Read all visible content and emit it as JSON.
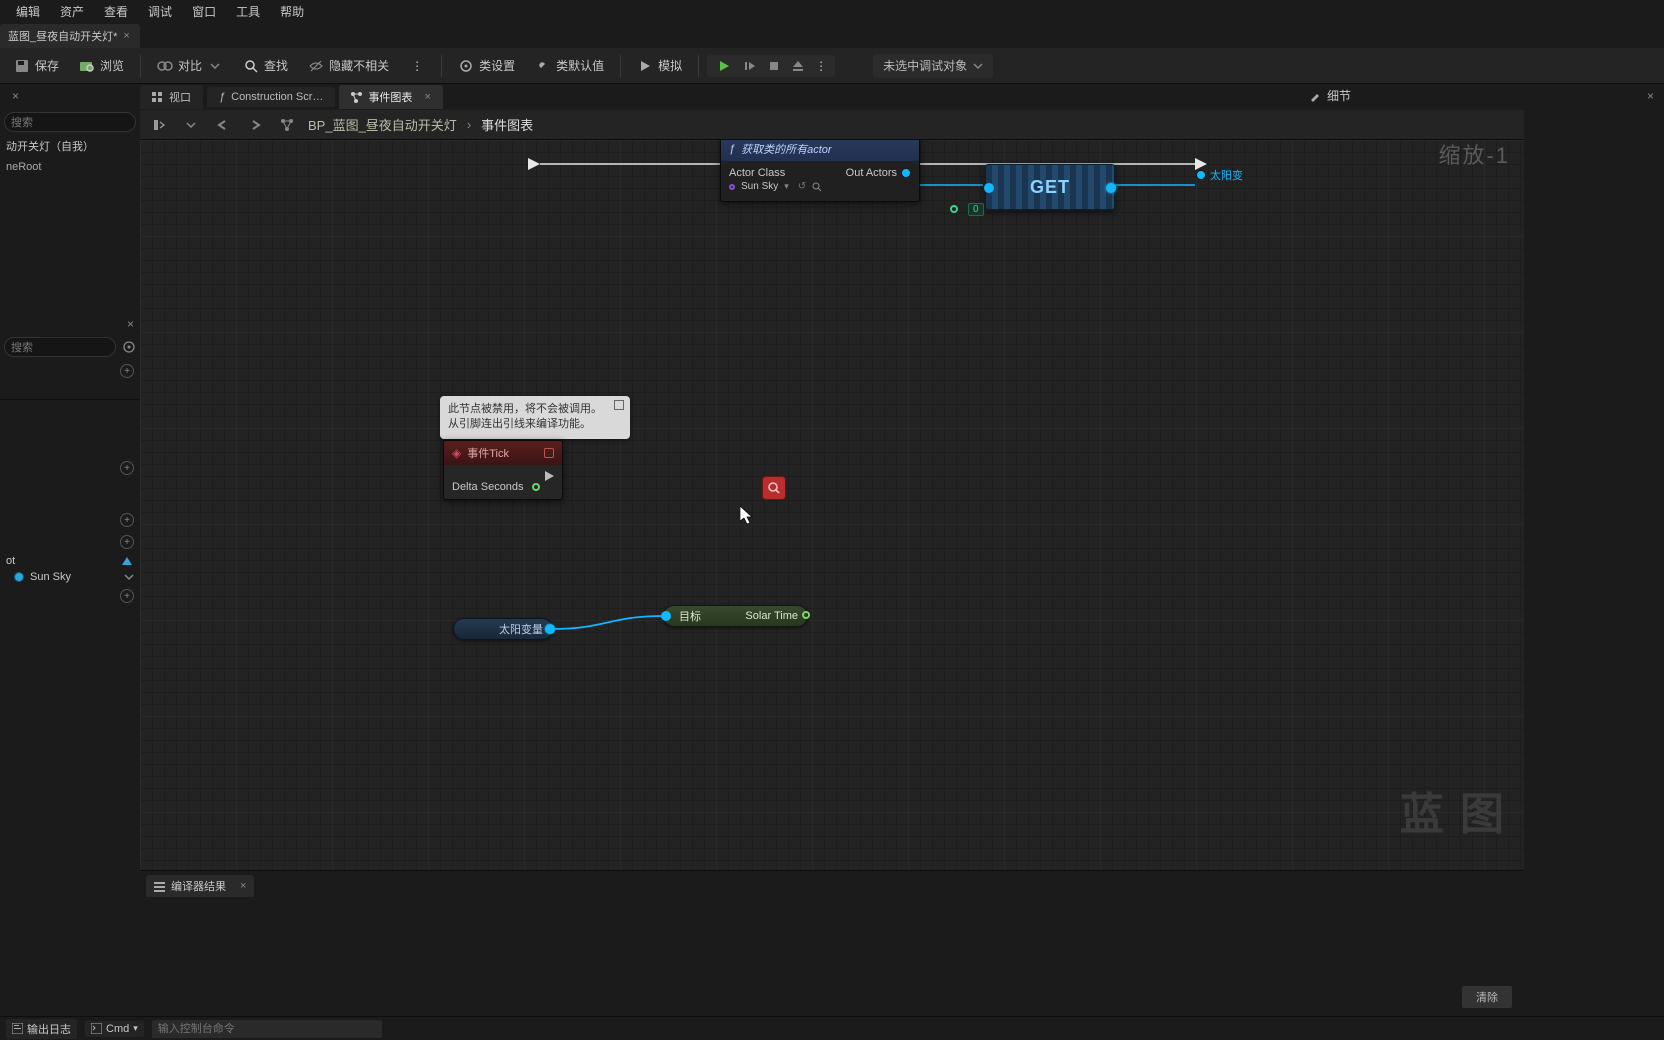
{
  "menu": {
    "items": [
      "编辑",
      "资产",
      "查看",
      "调试",
      "窗口",
      "工具",
      "帮助"
    ]
  },
  "doc_tab": {
    "title": "蓝图_昼夜自动开关灯*",
    "close": "×"
  },
  "toolbar": {
    "save": "保存",
    "browse": "浏览",
    "diff": "对比",
    "find": "查找",
    "hide": "隐藏不相关",
    "class_settings": "类设置",
    "class_defaults": "类默认值",
    "simulate": "模拟",
    "debug_target": "未选中调试对象"
  },
  "left": {
    "close": "×",
    "search_placeholder": "搜索",
    "self_item": "动开关灯（自我）",
    "root_item": "neRoot",
    "close2": "×",
    "my_blueprint_search": "搜索",
    "sections": [
      "",
      "",
      "",
      "",
      "",
      ""
    ],
    "var_parent": "ot",
    "var_name": "Sun Sky"
  },
  "mid_tabs": {
    "viewport": "视口",
    "construction": "Construction Scr…",
    "event_graph": "事件图表",
    "close": "×"
  },
  "details": {
    "label": "细节",
    "close": "×"
  },
  "graph": {
    "breadcrumb_root": "BP_蓝图_昼夜自动开关灯",
    "breadcrumb_sep": "›",
    "breadcrumb_leaf": "事件图表",
    "zoom": "缩放-1",
    "watermark": "蓝 图",
    "node_getall": {
      "title": "获取类的所有actor",
      "actor_class_lbl": "Actor Class",
      "actor_class_val": "Sun Sky",
      "out_actors": "Out Actors"
    },
    "node_get": {
      "label": "GET",
      "index": "0"
    },
    "node_sunvar": {
      "label": "太阳变"
    },
    "tick_tooltip": "此节点被禁用，将不会被调用。\n从引脚连出引线来编译功能。",
    "node_tick": {
      "title": "事件Tick",
      "delta": "Delta Seconds"
    },
    "var_pill": {
      "label": "太阳变量"
    },
    "solar": {
      "target": "目标",
      "solar_time": "Solar Time"
    }
  },
  "compiler": {
    "title": "编译器结果",
    "close": "×",
    "clear": "清除"
  },
  "bottom": {
    "output_log": "输出日志",
    "cmd": "Cmd",
    "cmd_placeholder": "输入控制台命令"
  }
}
